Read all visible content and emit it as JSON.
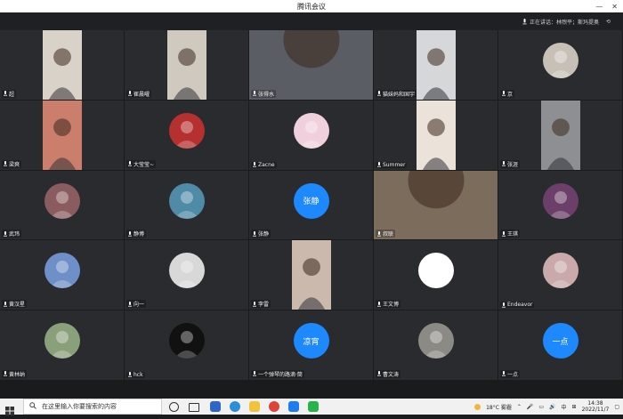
{
  "window": {
    "title": "腾讯会议"
  },
  "speaking": {
    "text": "正在讲话：林煦平；斯玛提奥"
  },
  "tiles": [
    {
      "name": "超",
      "kind": "video",
      "video_color": "#d9d2c8"
    },
    {
      "name": "崔晨曜",
      "kind": "video",
      "video_color": "#cfc9c0"
    },
    {
      "name": "张得水",
      "kind": "video-wide",
      "video_color": "#5a5d63"
    },
    {
      "name": "猫妹妈和国宇",
      "kind": "video",
      "video_color": "#d5d7d9"
    },
    {
      "name": "京",
      "kind": "avatar",
      "avatar_color": "#c7c0b6"
    },
    {
      "name": "梁爽",
      "kind": "video",
      "video_color": "#cc7e6c"
    },
    {
      "name": "大莹莹~",
      "kind": "avatar",
      "avatar_color": "#b5302f"
    },
    {
      "name": "Zacne",
      "kind": "avatar",
      "avatar_color": "#f0d0dc"
    },
    {
      "name": "Summer",
      "kind": "video",
      "video_color": "#ebe2da"
    },
    {
      "name": "张涯",
      "kind": "video",
      "video_color": "#8d8f93"
    },
    {
      "name": "武玮",
      "kind": "avatar",
      "avatar_color": "#8b5c5f"
    },
    {
      "name": "静博",
      "kind": "avatar",
      "avatar_color": "#4f8aa6"
    },
    {
      "name": "张静",
      "kind": "avatar-text",
      "avatar_text": "张静"
    },
    {
      "name": "叔联",
      "kind": "video-wide",
      "video_color": "#7b6c5c"
    },
    {
      "name": "王琪",
      "kind": "avatar",
      "avatar_color": "#6b3f6a"
    },
    {
      "name": "黄汉星",
      "kind": "avatar",
      "avatar_color": "#6e8fc7"
    },
    {
      "name": "向一",
      "kind": "avatar",
      "avatar_color": "#d8d8d8"
    },
    {
      "name": "李雷",
      "kind": "video",
      "video_color": "#cbb9ad"
    },
    {
      "name": "王文博",
      "kind": "avatar",
      "avatar_color": "#ffffff"
    },
    {
      "name": "Endeavor",
      "kind": "avatar",
      "avatar_color": "#c9a9a9"
    },
    {
      "name": "黄林纳",
      "kind": "avatar",
      "avatar_color": "#8aa07a"
    },
    {
      "name": "hck",
      "kind": "avatar",
      "avatar_color": "#111111"
    },
    {
      "name": "一个弹琴的路滴·筒",
      "kind": "avatar-text",
      "avatar_text": "凉宵"
    },
    {
      "name": "曹文涛",
      "kind": "avatar",
      "avatar_color": "#8c8a85"
    },
    {
      "name": "一点",
      "kind": "avatar-text",
      "avatar_text": "一点"
    }
  ],
  "taskbar": {
    "search_placeholder": "在这里输入你要搜索的内容",
    "weather": "18°C 雾霾",
    "ime": "中",
    "time": "14:38",
    "date": "2022/11/7"
  }
}
